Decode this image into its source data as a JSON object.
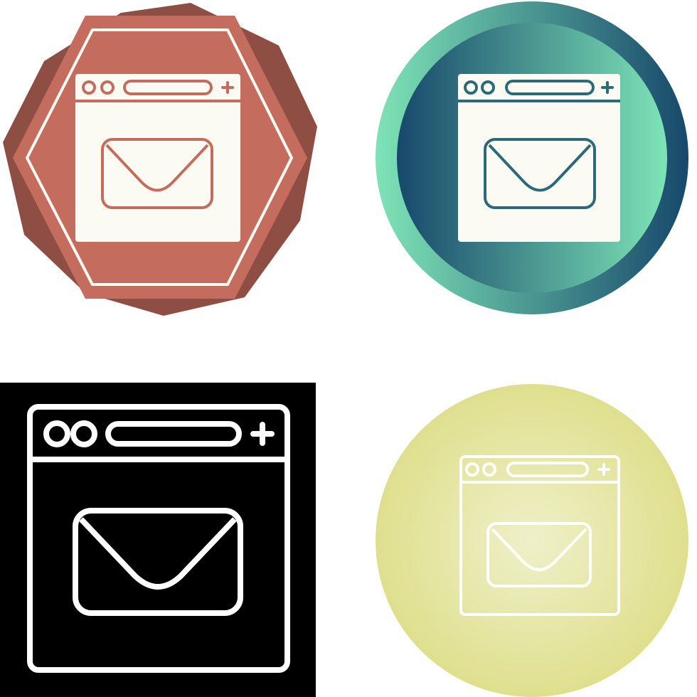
{
  "icon_set": {
    "subject": "browser-window-mail-icon",
    "variants": [
      {
        "style": "badge",
        "background": "#8f4e44",
        "shape": "#c46d5e",
        "foreground": "#fcfbf3"
      },
      {
        "style": "gradient-circle",
        "outer_from": "#7ee4b7",
        "outer_to": "#17486b",
        "inner_from": "#17486b",
        "inner_to": "#7ee4b7",
        "foreground": "#fcfbf3"
      },
      {
        "style": "glyph",
        "background": "#000000",
        "foreground": "#ffffff"
      },
      {
        "style": "line-circle",
        "background": "#dfe08e",
        "foreground": "#ffffff"
      }
    ]
  }
}
